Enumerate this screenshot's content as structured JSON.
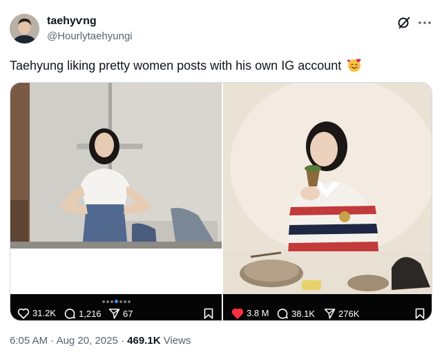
{
  "author": {
    "display_name": "taehyѵng",
    "handle": "@Hourlytaehyungi",
    "avatar_icon": "profile-photo"
  },
  "tweet": {
    "text": "Taehyung liking pretty women posts with his own IG account",
    "emoji": "smiling-face-with-hearts"
  },
  "media": [
    {
      "likes": "31.2K",
      "comments": "1,216",
      "shares": "67",
      "liked": false,
      "carousel_dots": 7,
      "active_dot": 3
    },
    {
      "likes": "3.8 M",
      "comments": "38.1K",
      "shares": "276K",
      "liked": true
    }
  ],
  "footer": {
    "time": "6:05 AM",
    "separator": "·",
    "date": "Aug 20, 2025",
    "views_count": "469.1K",
    "views_label": "Views"
  },
  "colors": {
    "handle_gray": "#536471",
    "like_red": "#ff3040",
    "carousel_active": "#3b97f0"
  }
}
